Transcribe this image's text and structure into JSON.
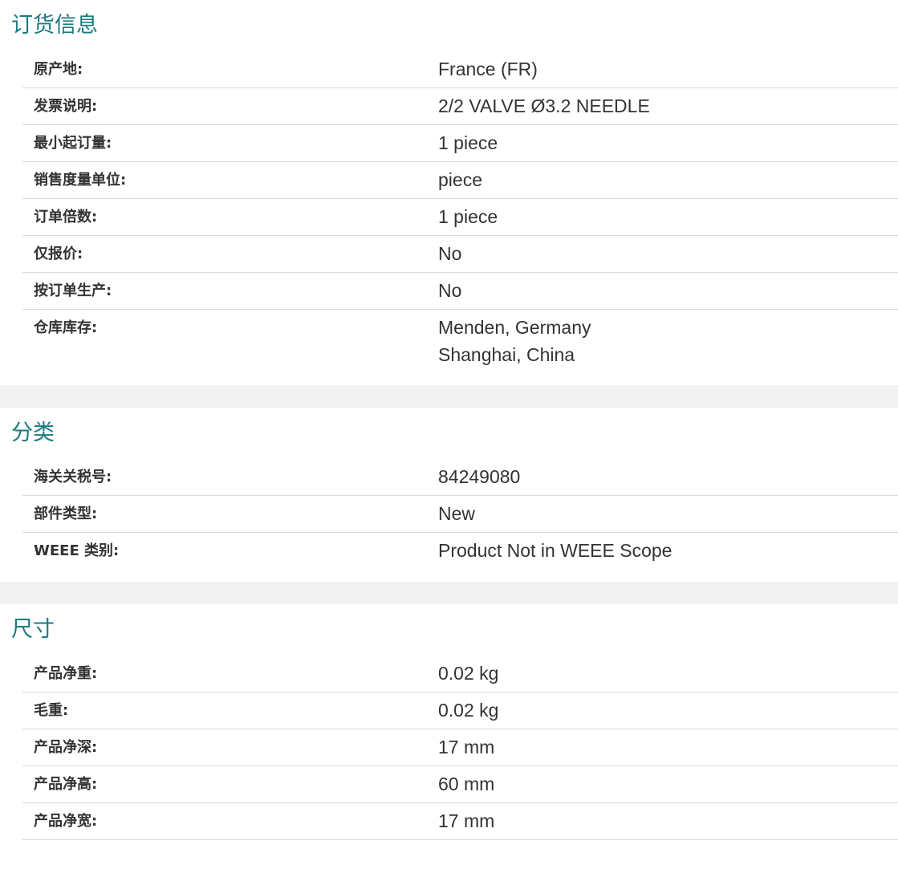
{
  "ordering": {
    "title": "订货信息",
    "rows": [
      {
        "label": "原产地:",
        "value": "France (FR)"
      },
      {
        "label": "发票说明:",
        "value": "2/2 VALVE Ø3.2 NEEDLE"
      },
      {
        "label": "最小起订量:",
        "value": "1 piece"
      },
      {
        "label": "销售度量单位:",
        "value": "piece"
      },
      {
        "label": "订单倍数:",
        "value": "1 piece"
      },
      {
        "label": "仅报价:",
        "value": "No"
      },
      {
        "label": "按订单生产:",
        "value": "No"
      },
      {
        "label": "仓库库存:",
        "values": [
          "Menden, Germany",
          "Shanghai, China"
        ]
      }
    ]
  },
  "classification": {
    "title": "分类",
    "rows": [
      {
        "label": "海关关税号:",
        "value": "84249080"
      },
      {
        "label": "部件类型:",
        "value": "New"
      },
      {
        "label": "WEEE 类别:",
        "value": "Product Not in WEEE Scope"
      }
    ]
  },
  "dimensions": {
    "title": "尺寸",
    "rows": [
      {
        "label": "产品净重:",
        "value": "0.02 kg"
      },
      {
        "label": "毛重:",
        "value": "0.02 kg"
      },
      {
        "label": "产品净深:",
        "value": "17 mm"
      },
      {
        "label": "产品净高:",
        "value": "60 mm"
      },
      {
        "label": "产品净宽:",
        "value": "17 mm"
      }
    ]
  },
  "colors": {
    "heading": "#1a7a80",
    "divider": "#d9d9d9",
    "gap": "#f2f2f2"
  }
}
